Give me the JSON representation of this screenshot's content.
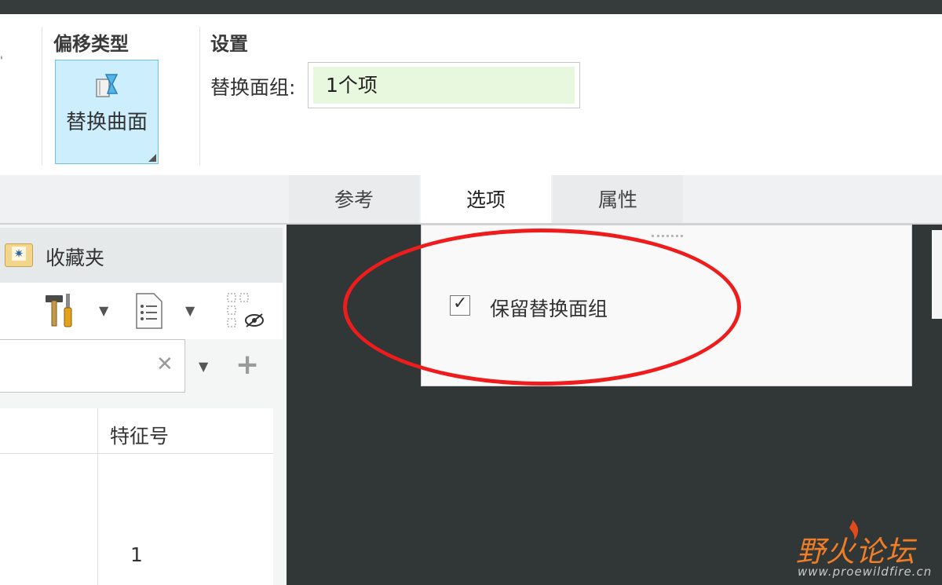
{
  "ribbon": {
    "offset_type": {
      "title": "偏移类型",
      "button_label": "替换曲面"
    },
    "settings": {
      "title": "设置",
      "quilt_label": "替换面组:",
      "quilt_value": "1个项"
    }
  },
  "tabs": [
    {
      "label": "参考",
      "active": false
    },
    {
      "label": "选项",
      "active": true
    },
    {
      "label": "属性",
      "active": false
    }
  ],
  "left_panel": {
    "favorites_label": "收藏夹",
    "search": {
      "value": "",
      "placeholder": ""
    },
    "tree": {
      "column_header": "特征号",
      "rows": [
        {
          "feature_no": "1"
        }
      ]
    }
  },
  "options_panel": {
    "keep_quilt": {
      "label": "保留替换面组",
      "checked": true
    }
  },
  "watermark": {
    "cn": "野火论坛",
    "url": "www.proewildfire.cn"
  },
  "colors": {
    "annotation": "#ee1c1c",
    "selected_button": "#cdeefc",
    "quilt_field": "#e8f8de",
    "viewport": "#313636"
  }
}
